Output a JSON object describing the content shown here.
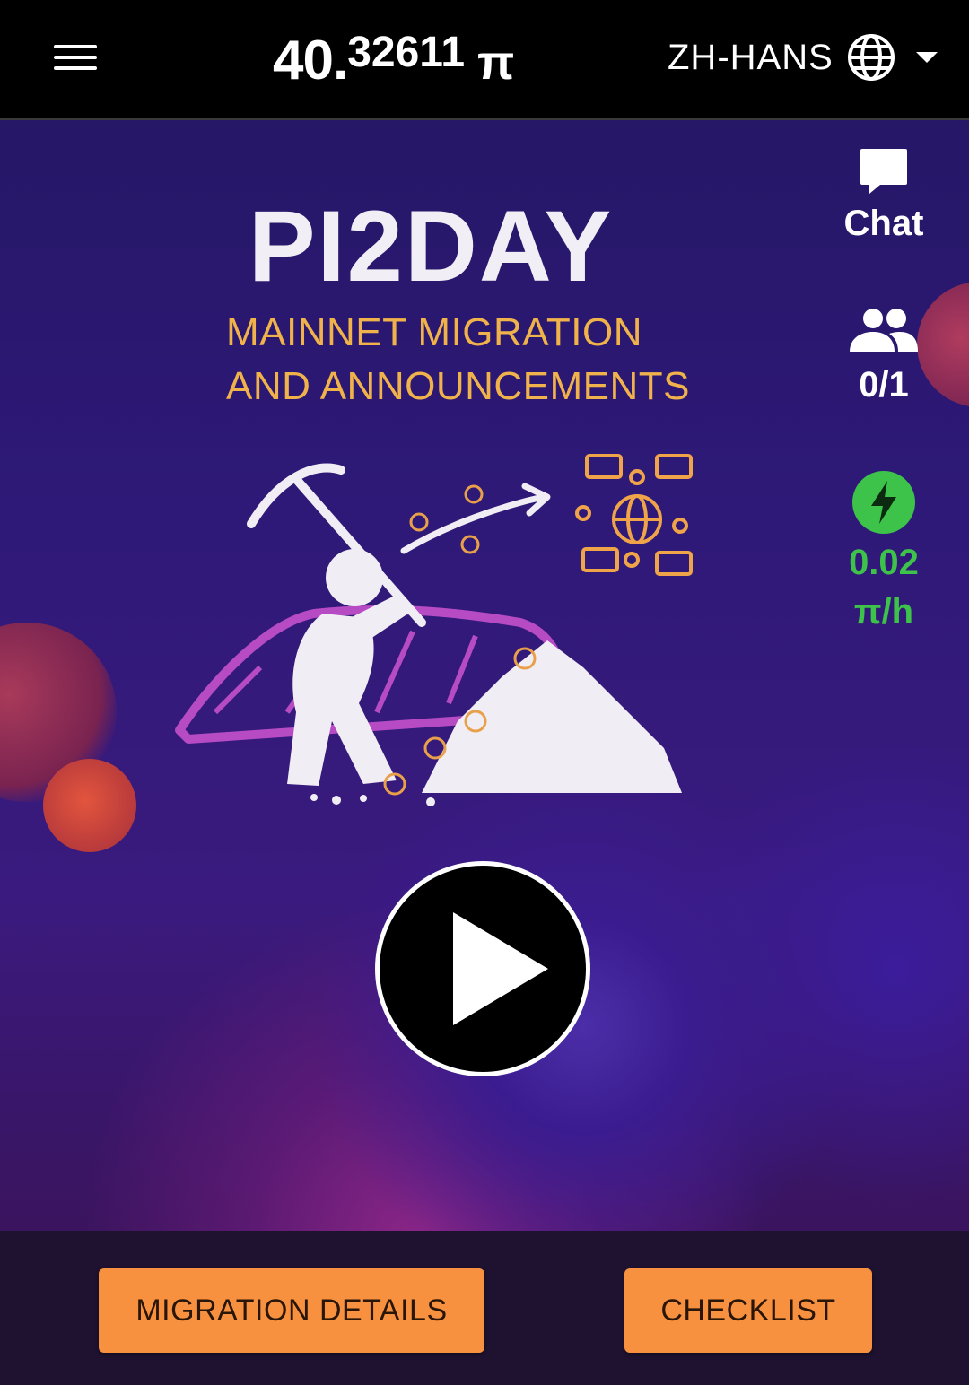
{
  "header": {
    "balance_integer": "40.",
    "balance_decimal": "32611",
    "currency_symbol": "π",
    "language_code": "ZH-HANS"
  },
  "promo": {
    "title": "PI2DAY",
    "subtitle_line1": "MAINNET MIGRATION",
    "subtitle_line2": "AND ANNOUNCEMENTS"
  },
  "sidebar": {
    "chat_label": "Chat",
    "team_count": "0/1",
    "mining_rate": "0.02",
    "mining_unit": "π/h"
  },
  "actions": {
    "migration_details_label": "MIGRATION DETAILS",
    "checklist_label": "CHECKLIST"
  },
  "colors": {
    "accent_orange": "#f7913f",
    "mining_green": "#3ec34a",
    "title_gold": "#f0b24a",
    "background_purple": "#2e1978"
  },
  "icons": [
    "menu-icon",
    "globe-icon",
    "dropdown-caret-icon",
    "chat-bubble-icon",
    "team-icon",
    "lightning-icon",
    "play-icon"
  ]
}
